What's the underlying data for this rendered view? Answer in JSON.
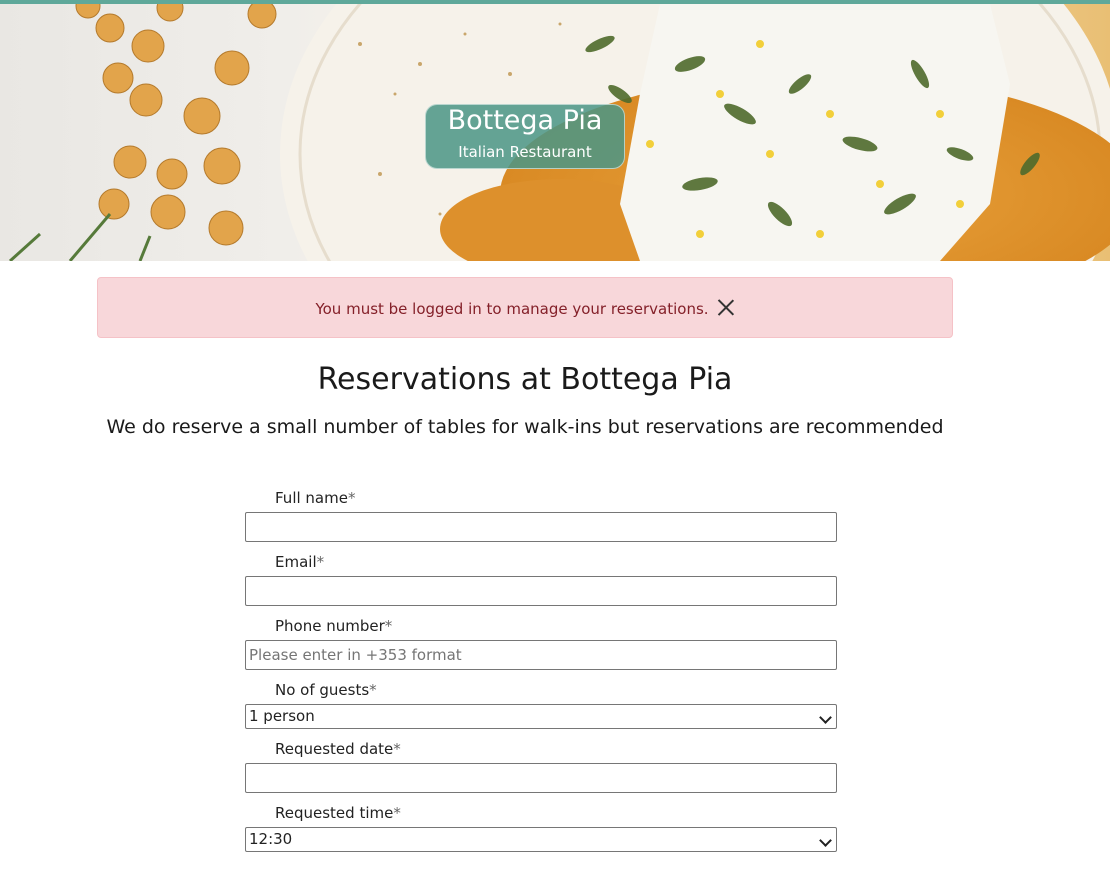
{
  "brand": {
    "name": "Bottega Pia",
    "tagline": "Italian Restaurant"
  },
  "alert": {
    "message": "You must be logged in to manage your reservations.",
    "close_icon": "close-icon"
  },
  "page": {
    "title": "Reservations at Bottega Pia",
    "subtitle": "We do reserve a small number of tables for walk-ins but reservations are recommended"
  },
  "form": {
    "required_marker": "*",
    "full_name": {
      "label": "Full name",
      "value": ""
    },
    "email": {
      "label": "Email",
      "value": ""
    },
    "phone": {
      "label": "Phone number",
      "value": "",
      "placeholder": "Please enter in +353 format"
    },
    "guests": {
      "label": "No of guests",
      "selected": "1 person"
    },
    "date": {
      "label": "Requested date",
      "value": ""
    },
    "time": {
      "label": "Requested time",
      "selected": "12:30"
    }
  },
  "colors": {
    "accent": "#5fa89a",
    "brand_box": "#4c9686",
    "alert_bg": "#f8d7da",
    "alert_text": "#842029"
  }
}
